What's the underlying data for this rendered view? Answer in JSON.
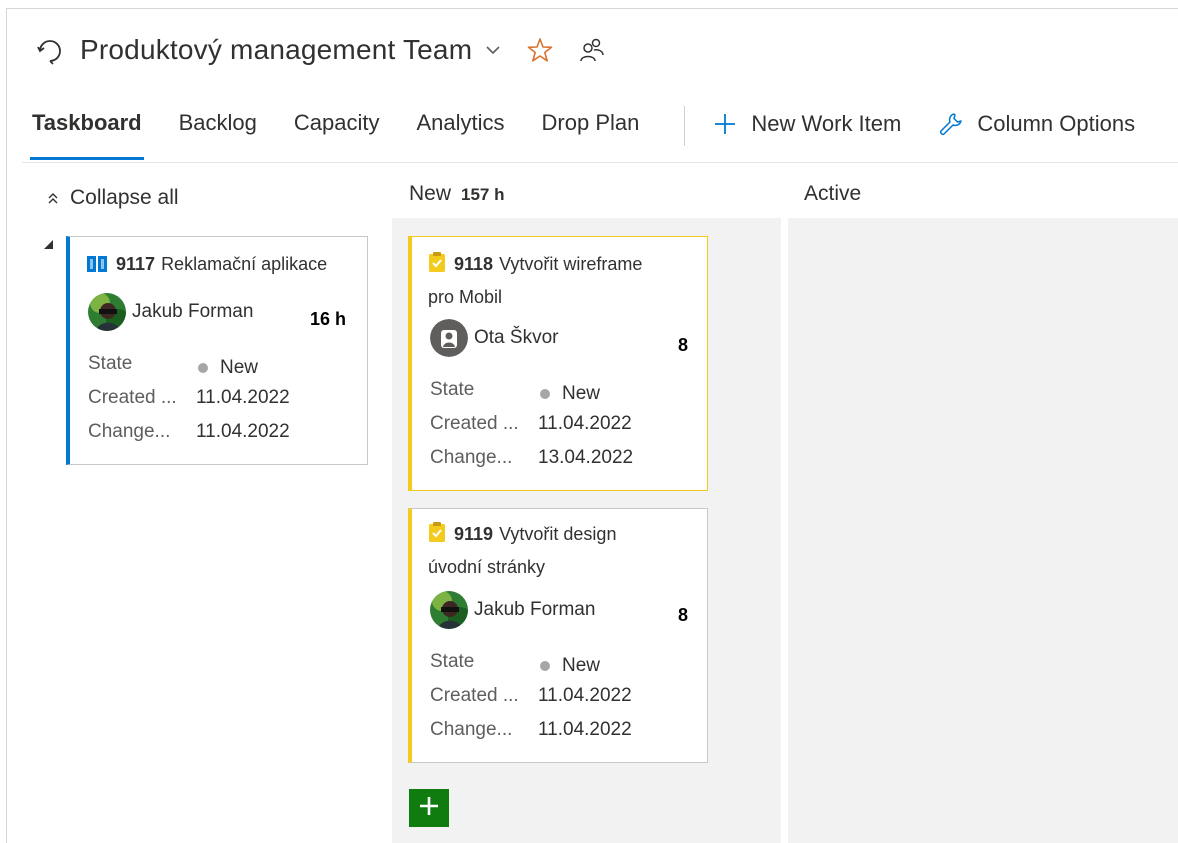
{
  "header": {
    "team_name": "Produktový management Team"
  },
  "tabs": [
    {
      "label": "Taskboard",
      "active": true
    },
    {
      "label": "Backlog"
    },
    {
      "label": "Capacity"
    },
    {
      "label": "Analytics"
    },
    {
      "label": "Drop Plan"
    }
  ],
  "commands": {
    "new_work_item": "New Work Item",
    "column_options": "Column Options"
  },
  "collapse_all": "Collapse all",
  "columns": {
    "new": {
      "label": "New",
      "hours": "157 h"
    },
    "active": {
      "label": "Active"
    }
  },
  "field_labels": {
    "state": "State",
    "created": "Created ...",
    "changed": "Change..."
  },
  "parent_card": {
    "id": "9117",
    "title": "Reklamační aplikace",
    "assignee": "Jakub Forman",
    "effort": "16 h",
    "state": "New",
    "created": "11.04.2022",
    "changed": "11.04.2022"
  },
  "tasks": [
    {
      "id": "9118",
      "title_line1": "Vytvořit wireframe",
      "title_line2": "pro Mobil",
      "assignee": "Ota Škvor",
      "effort": "8",
      "state": "New",
      "created": "11.04.2022",
      "changed": "13.04.2022"
    },
    {
      "id": "9119",
      "title_line1": "Vytvořit design",
      "title_line2": "úvodní stránky",
      "assignee": "Jakub Forman",
      "effort": "8",
      "state": "New",
      "created": "11.04.2022",
      "changed": "11.04.2022"
    }
  ],
  "colors": {
    "accent_blue": "#0078d4",
    "task_yellow": "#f2cb1d",
    "add_green": "#107c10",
    "star_orange": "#d9732b"
  }
}
